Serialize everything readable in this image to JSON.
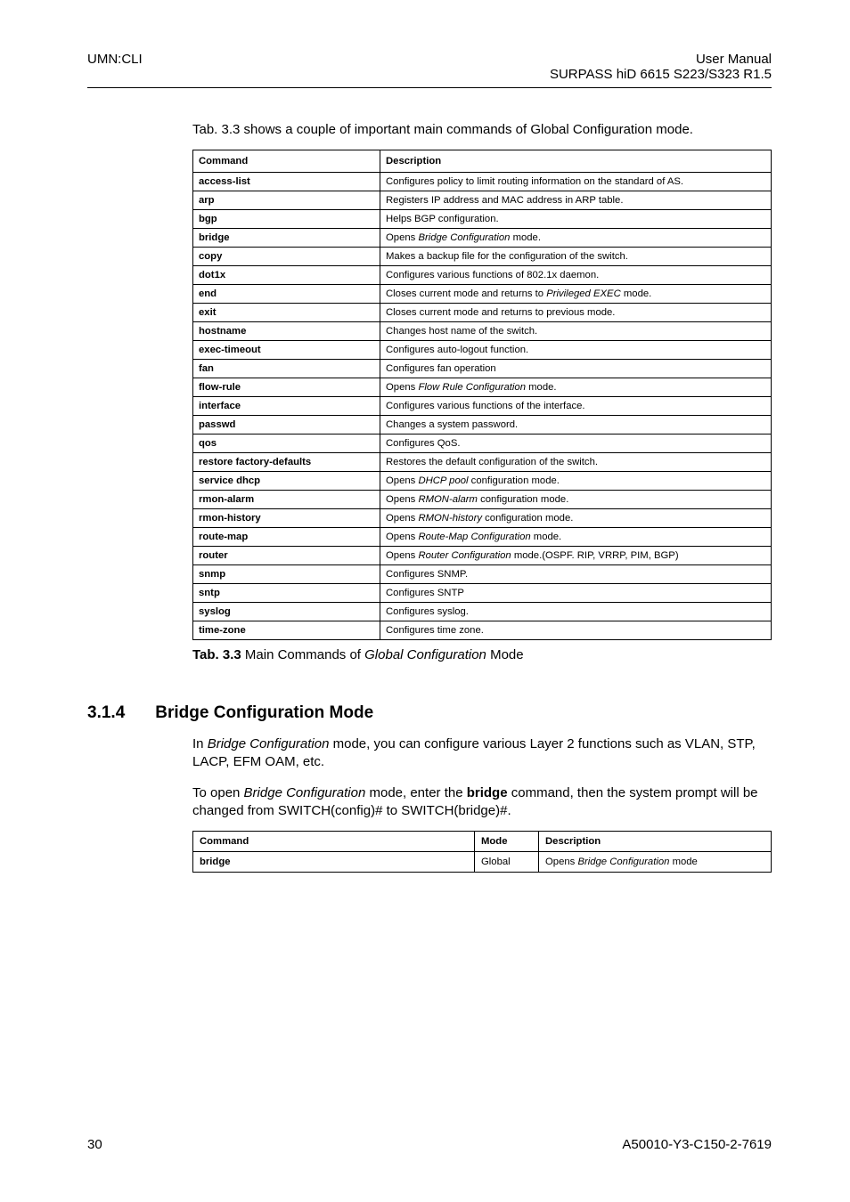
{
  "header": {
    "left": "UMN:CLI",
    "right_line1": "User Manual",
    "right_line2": "SURPASS hiD 6615 S223/S323 R1.5"
  },
  "intro": "Tab. 3.3 shows a couple of important main commands of Global Configuration mode.",
  "table": {
    "head": {
      "col1": "Command",
      "col2": "Description"
    },
    "rows": [
      {
        "cmd": "access-list",
        "desc_pre": "Configures policy to limit routing information on the standard of AS.",
        "em": "",
        "desc_post": ""
      },
      {
        "cmd": "arp",
        "desc_pre": "Registers IP address and MAC address in ARP table.",
        "em": "",
        "desc_post": ""
      },
      {
        "cmd": "bgp",
        "desc_pre": "Helps BGP configuration.",
        "em": "",
        "desc_post": ""
      },
      {
        "cmd": "bridge",
        "desc_pre": "Opens ",
        "em": "Bridge Configuration",
        "desc_post": " mode."
      },
      {
        "cmd": "copy",
        "desc_pre": "Makes a backup file for the configuration of the switch.",
        "em": "",
        "desc_post": ""
      },
      {
        "cmd": "dot1x",
        "desc_pre": "Configures various functions of 802.1x daemon.",
        "em": "",
        "desc_post": ""
      },
      {
        "cmd": "end",
        "desc_pre": "Closes current mode and returns to ",
        "em": "Privileged EXEC",
        "desc_post": " mode."
      },
      {
        "cmd": "exit",
        "desc_pre": "Closes current mode and returns to previous mode.",
        "em": "",
        "desc_post": ""
      },
      {
        "cmd": "hostname",
        "desc_pre": "Changes host name of the switch.",
        "em": "",
        "desc_post": ""
      },
      {
        "cmd": "exec-timeout",
        "desc_pre": "Configures auto-logout function.",
        "em": "",
        "desc_post": ""
      },
      {
        "cmd": "fan",
        "desc_pre": "Configures fan operation",
        "em": "",
        "desc_post": ""
      },
      {
        "cmd": "flow-rule",
        "desc_pre": "Opens ",
        "em": "Flow Rule Configuration",
        "desc_post": " mode."
      },
      {
        "cmd": "interface",
        "desc_pre": "Configures various functions of the interface.",
        "em": "",
        "desc_post": ""
      },
      {
        "cmd": "passwd",
        "desc_pre": "Changes a system password.",
        "em": "",
        "desc_post": ""
      },
      {
        "cmd": "qos",
        "desc_pre": "Configures QoS.",
        "em": "",
        "desc_post": ""
      },
      {
        "cmd": "restore factory-defaults",
        "desc_pre": "Restores the default configuration of the switch.",
        "em": "",
        "desc_post": ""
      },
      {
        "cmd": "service dhcp",
        "desc_pre": "Opens ",
        "em": "DHCP pool",
        "desc_post": " configuration mode."
      },
      {
        "cmd": "rmon-alarm",
        "desc_pre": "Opens ",
        "em": "RMON-alarm",
        "desc_post": " configuration mode."
      },
      {
        "cmd": "rmon-history",
        "desc_pre": "Opens ",
        "em": "RMON-history",
        "desc_post": " configuration mode."
      },
      {
        "cmd": "route-map",
        "desc_pre": "Opens ",
        "em": "Route-Map Configuration",
        "desc_post": " mode."
      },
      {
        "cmd": "router",
        "desc_pre": "Opens ",
        "em": "Router Configuration",
        "desc_post": " mode.(OSPF. RIP, VRRP, PIM, BGP)"
      },
      {
        "cmd": "snmp",
        "desc_pre": "Configures SNMP.",
        "em": "",
        "desc_post": ""
      },
      {
        "cmd": "sntp",
        "desc_pre": "Configures SNTP",
        "em": "",
        "desc_post": ""
      },
      {
        "cmd": "syslog",
        "desc_pre": "Configures syslog.",
        "em": "",
        "desc_post": ""
      },
      {
        "cmd": "time-zone",
        "desc_pre": "Configures time zone.",
        "em": "",
        "desc_post": ""
      }
    ]
  },
  "caption": {
    "strong": "Tab. 3.3",
    "pre": "   Main Commands of ",
    "em": "Global Configuration",
    "post": " Mode"
  },
  "section": {
    "num": "3.1.4",
    "title": "Bridge Configuration Mode"
  },
  "para1": {
    "pre": "In ",
    "em": "Bridge Configuration",
    "post": " mode, you can configure various Layer 2 functions such as VLAN, STP, LACP, EFM OAM, etc."
  },
  "para2": {
    "pre": "To open ",
    "em1": "Bridge Configuration",
    "mid": " mode, enter the ",
    "bold": "bridge",
    "post": " command, then the system prompt will be changed from SWITCH(config)# to SWITCH(bridge)#."
  },
  "cmdtable": {
    "head": {
      "c1": "Command",
      "c2": "Mode",
      "c3": "Description"
    },
    "row": {
      "c1": "bridge",
      "c2": "Global",
      "c3_pre": "Opens ",
      "c3_em": "Bridge Configuration",
      "c3_post": " mode"
    }
  },
  "footer": {
    "left": "30",
    "right": "A50010-Y3-C150-2-7619"
  }
}
